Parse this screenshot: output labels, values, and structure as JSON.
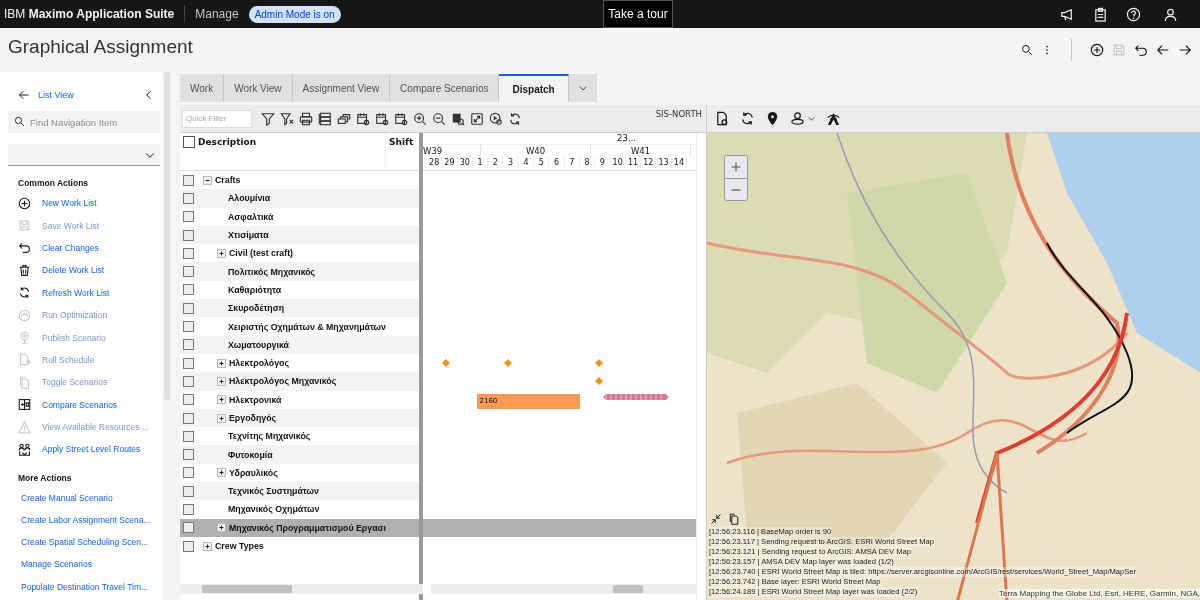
{
  "top_bar": {
    "brand": "IBM **Maximo Application Suite**",
    "app": "Manage",
    "badge": "Admin Mode is on",
    "tour_button": "Take a tour"
  },
  "page": {
    "title": "Graphical Assignment"
  },
  "nav": {
    "back_link": "List View",
    "search": {
      "placeholder": "Find Navigation Item"
    },
    "sections": [
      {
        "heading": "Common Actions",
        "kind": "icons",
        "items": [
          {
            "label": "New Work List",
            "disabled": false
          },
          {
            "label": "Save Work List",
            "disabled": true
          },
          {
            "label": "Clear Changes",
            "disabled": false
          },
          {
            "label": "Delete Work List",
            "disabled": false
          },
          {
            "label": "Refresh Work List",
            "disabled": false
          },
          {
            "label": "Run Optimization",
            "disabled": true
          },
          {
            "label": "Publish Scenario",
            "disabled": true
          },
          {
            "label": "Roll Schedule",
            "disabled": true
          },
          {
            "label": "Toggle Scenarios",
            "disabled": true
          },
          {
            "label": "Compare Scenarios",
            "disabled": false
          },
          {
            "label": "View Available Resources ...",
            "disabled": true
          },
          {
            "label": "Apply Street Level Routes",
            "disabled": false
          }
        ]
      },
      {
        "heading": "More Actions",
        "kind": "links",
        "items": [
          {
            "label": "Create Manual Scenario",
            "disabled": false
          },
          {
            "label": "Create Labor Assignment Scena...",
            "disabled": false
          },
          {
            "label": "Create Spatial Scheduling Scen...",
            "disabled": false
          },
          {
            "label": "Manage Scenarios",
            "disabled": false
          },
          {
            "label": "Populate Destination Travel Tim...",
            "disabled": false
          }
        ]
      }
    ]
  },
  "tabs": [
    {
      "label": "Work",
      "selected": false
    },
    {
      "label": "Work View",
      "selected": false
    },
    {
      "label": "Assignment View",
      "selected": false
    },
    {
      "label": "Compare Scenarios",
      "selected": false
    },
    {
      "label": "Dispatch",
      "selected": true
    }
  ],
  "grid": {
    "quick_filter": {
      "placeholder": "Quick Filter"
    },
    "select_all": false,
    "region": "SIS-NORTH",
    "columns": [
      "Description",
      "Shift"
    ],
    "timeline": {
      "month": "23...",
      "weeks": [
        "W39",
        "W40",
        "W41"
      ],
      "days": [
        "28",
        "29",
        "30",
        "1",
        "2",
        "3",
        "4",
        "5",
        "6",
        "7",
        "8",
        "9",
        "10",
        "11",
        "12",
        "13",
        "14"
      ]
    },
    "rows": [
      {
        "label": "Crafts",
        "kind": "group",
        "expanded": true,
        "selected": false,
        "children": [
          {
            "label": "Αλουμίνια",
            "kind": "item",
            "selected": false
          },
          {
            "label": "Ασφαλτικά",
            "kind": "item",
            "selected": false
          },
          {
            "label": "Χτισίματα",
            "kind": "item",
            "selected": false
          },
          {
            "label": "Civil (test craft)",
            "kind": "group",
            "expanded": false,
            "selected": false
          },
          {
            "label": "Πολιτικός Μηχανικός",
            "kind": "item",
            "selected": false
          },
          {
            "label": "Καθαριότητα",
            "kind": "item",
            "selected": false
          },
          {
            "label": "Σκυροδέτηση",
            "kind": "item",
            "selected": false
          },
          {
            "label": "Χειριστής Οχημάτων & Μηχανημάτων",
            "kind": "item",
            "selected": false
          },
          {
            "label": "Χωματουργικά",
            "kind": "item",
            "selected": false
          },
          {
            "label": "Ηλεκτρολόγος",
            "kind": "group",
            "expanded": false,
            "selected": false,
            "marks": [
              {
                "kind": "diamond"
              },
              {
                "kind": "diamond"
              },
              {
                "kind": "diamond"
              }
            ]
          },
          {
            "label": "Ηλεκτρολόγος Μηχανικός",
            "kind": "group",
            "expanded": false,
            "selected": false,
            "marks": [
              {
                "kind": "diamond"
              }
            ]
          },
          {
            "label": "Ηλεκτρονικά",
            "kind": "group",
            "expanded": false,
            "selected": false,
            "marks": [
              {
                "kind": "bar",
                "label": "2160"
              },
              {
                "kind": "hatched_bar"
              }
            ]
          },
          {
            "label": "Εργοδηγός",
            "kind": "group",
            "expanded": false,
            "selected": false
          },
          {
            "label": "Τεχνίτης Μηχανικός",
            "kind": "item",
            "selected": false
          },
          {
            "label": "Φυτοκομία",
            "kind": "item",
            "selected": false
          },
          {
            "label": "Υδραυλικός",
            "kind": "group",
            "expanded": false,
            "selected": false
          },
          {
            "label": "Τεχνικός Συστημάτων",
            "kind": "item",
            "selected": false
          },
          {
            "label": "Μηχανικός Οχημάτων",
            "kind": "item",
            "selected": false
          },
          {
            "label": "Μηχανικός Προγραμματισμού Εργασι",
            "kind": "group",
            "expanded": false,
            "selected": true
          }
        ]
      },
      {
        "label": "Crew Types",
        "kind": "group",
        "expanded": false,
        "selected": false
      }
    ]
  },
  "map": {
    "kind": "picture",
    "log": [
      "[12:56:23.116 | BaseMap order is 90",
      "[12:56:23.117 | Sending request to ArcGIS: ESRI World Street Map",
      "[12:56:23.121 | Sending request to ArcGIS: AMSA DEV Map",
      "[12:56:23.157 | AMSA DEV Map layer was loaded (1/2)",
      "[12:56:23.740 | ESRI World Street Map is tiled: https://server.arcgisonline.com/ArcGIS/rest/services/World_Street_Map/MapSer",
      "[12:56:23.742 | Base layer: ESRI World Street Map",
      "[12:56:24.189 | ESRI World Street Map layer was loaded (2/2)"
    ],
    "attribution": "Terra Mapping the Globe Ltd, Esri, HERE, Garmin, NGA,"
  }
}
